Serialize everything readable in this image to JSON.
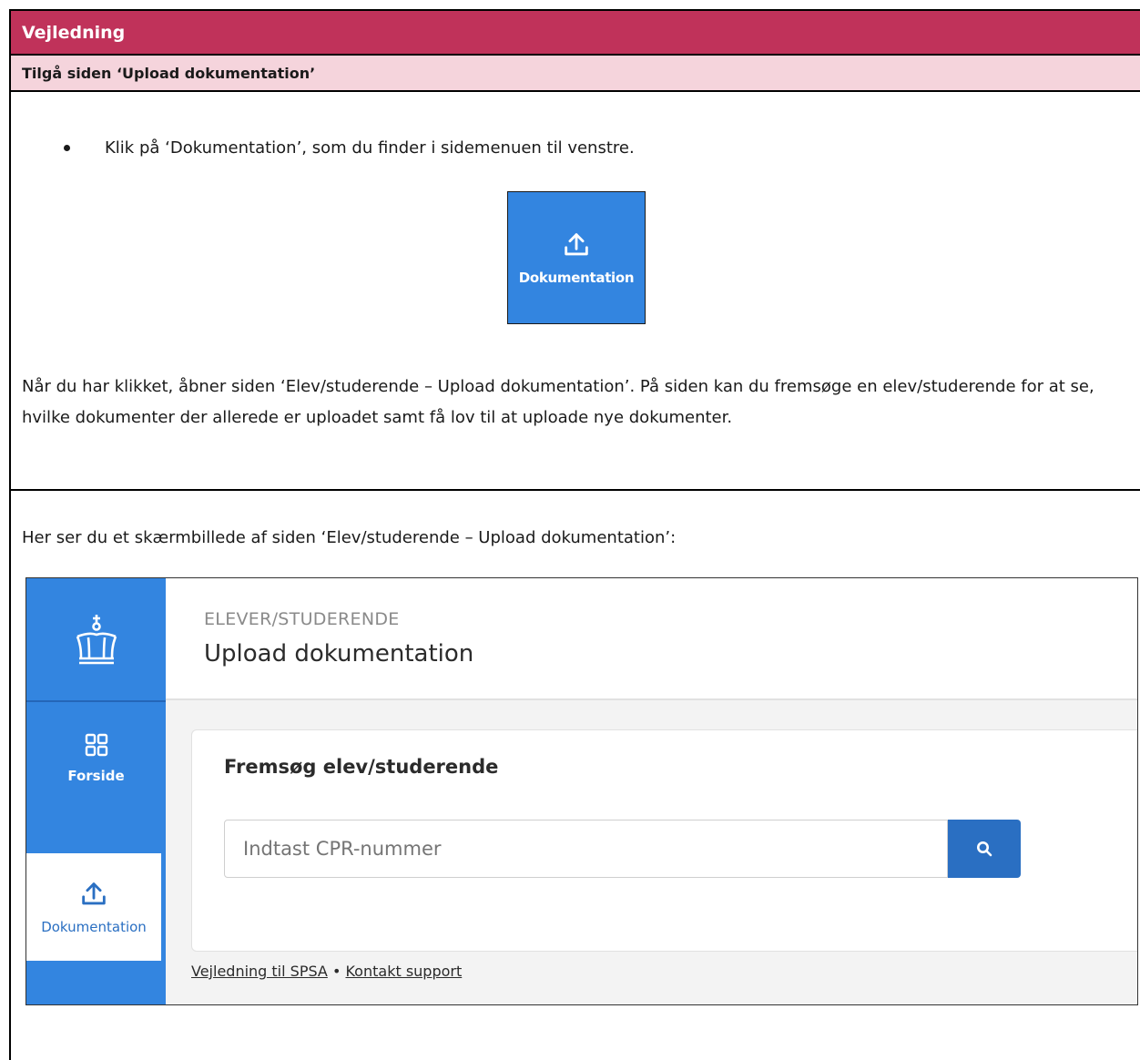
{
  "header": {
    "title": "Vejledning"
  },
  "section": {
    "title": "Tilgå siden ‘Upload dokumentation’"
  },
  "bullet": {
    "text": "Klik på ‘Dokumentation’, som du finder i sidemenuen til venstre."
  },
  "tile": {
    "label": "Dokumentation",
    "icon": "upload-icon"
  },
  "paragraph": "Når du har klikket, åbner siden ‘Elev/studerende – Upload dokumentation’. På siden kan du fremsøge en elev/studerende for at se, hvilke dokumenter der allerede er uploadet samt få lov til at uploade nye dokumenter.",
  "intro": "Her ser du et skærmbillede af siden ‘Elev/studerende – Upload dokumentation’:",
  "screenshot": {
    "sidebar": {
      "logo_icon": "crown-icon",
      "items": [
        {
          "label": "Forside",
          "icon": "grid-icon"
        },
        {
          "label": "Dokumentation",
          "icon": "upload-icon",
          "active": true
        }
      ]
    },
    "breadcrumb": "ELEVER/STUDERENDE",
    "page_title": "Upload dokumentation",
    "search": {
      "title": "Fremsøg elev/studerende",
      "placeholder": "Indtast CPR-nummer",
      "button_icon": "search-icon"
    },
    "footer_links": [
      "Vejledning til SPSA",
      "Kontakt support"
    ],
    "footer_separator": "•"
  },
  "colors": {
    "header": "#c0325a",
    "subheader": "#f5d4dc",
    "brand_blue": "#3385e0",
    "button_blue": "#2a6fc2"
  }
}
